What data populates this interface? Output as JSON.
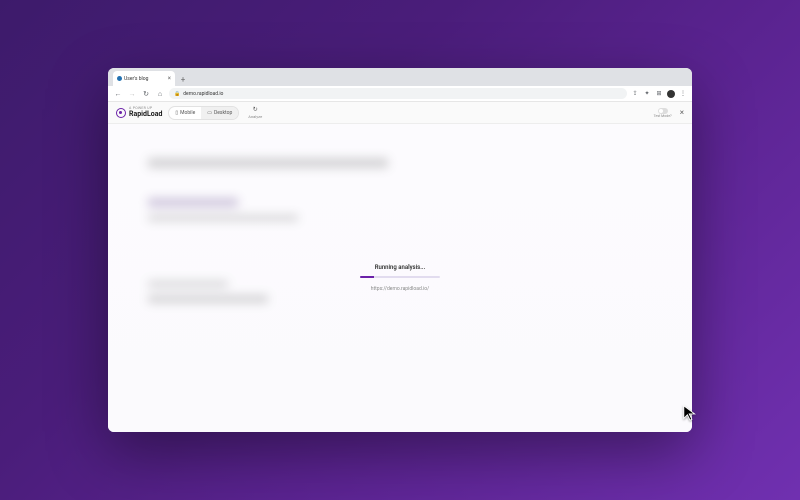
{
  "browser": {
    "tab_title": "User's blog",
    "new_tab_label": "+",
    "tab_close_label": "×",
    "address_url": "demo.rapidload.io",
    "nav": {
      "back": "←",
      "forward": "→",
      "reload": "↻",
      "home": "⌂"
    },
    "menu_dots": "⋮"
  },
  "app": {
    "brand_overline": "A POWER UP",
    "brand_name": "RapidLoad",
    "device_tabs": {
      "mobile": "Mobile",
      "desktop": "Desktop"
    },
    "analyze_label": "Analyze",
    "test_mode_label": "Test Mode?",
    "close_label": "×"
  },
  "loading": {
    "status_text": "Running analysis...",
    "target_url": "https://demo.rapidload.io/",
    "progress_percent": 18
  },
  "colors": {
    "accent": "#6b21a8",
    "bg_gradient_start": "#3d1b6b",
    "bg_gradient_end": "#7030b0"
  }
}
